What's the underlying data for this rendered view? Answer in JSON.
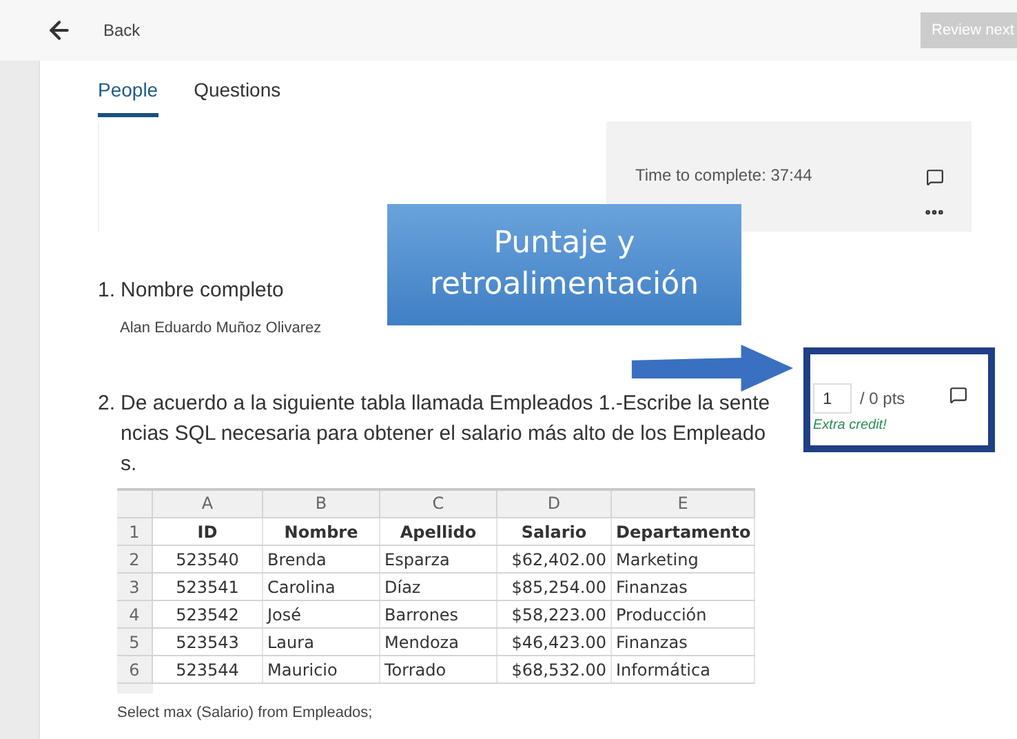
{
  "top_bar": {
    "back_label": "Back",
    "review_button": "Review next"
  },
  "tabs": [
    {
      "label": "People",
      "selected": true
    },
    {
      "label": "Questions",
      "selected": false
    }
  ],
  "summary": {
    "time": "Time to complete: 37:44"
  },
  "callout": {
    "text": "Puntaje y retroalimentación"
  },
  "questions": [
    {
      "number": "1.",
      "title": "Nombre completo",
      "answer": "Alan Eduardo Muñoz Olivarez"
    },
    {
      "number": "2.",
      "title": "De acuerdo a la siguiente tabla llamada Empleados 1.-Escribe la sentencias SQL necesaria para obtener el salario más alto de los Empleados.",
      "score": {
        "value": "1",
        "total": "/ 0 pts",
        "note": "Extra credit!"
      },
      "table": {
        "columns": [
          "A",
          "B",
          "C",
          "D",
          "E"
        ],
        "rows": [
          {
            "row": "1",
            "kind": "header",
            "cells": [
              "ID",
              "Nombre",
              "Apellido",
              "Salario",
              "Departamento"
            ]
          },
          {
            "row": "2",
            "kind": "data",
            "cells": [
              "523540",
              "Brenda",
              "Esparza",
              "$62,402.00",
              "Marketing"
            ]
          },
          {
            "row": "3",
            "kind": "data",
            "cells": [
              "523541",
              "Carolina",
              "Díaz",
              "$85,254.00",
              "Finanzas"
            ]
          },
          {
            "row": "4",
            "kind": "data",
            "cells": [
              "523542",
              "José",
              "Barrones",
              "$58,223.00",
              "Producción"
            ]
          },
          {
            "row": "5",
            "kind": "data",
            "cells": [
              "523543",
              "Laura",
              "Mendoza",
              "$46,423.00",
              "Finanzas"
            ]
          },
          {
            "row": "6",
            "kind": "data",
            "cells": [
              "523544",
              "Mauricio",
              "Torrado",
              "$68,532.00",
              "Informática"
            ]
          }
        ]
      },
      "answer": "Select max (Salario) from Empleados;"
    }
  ]
}
